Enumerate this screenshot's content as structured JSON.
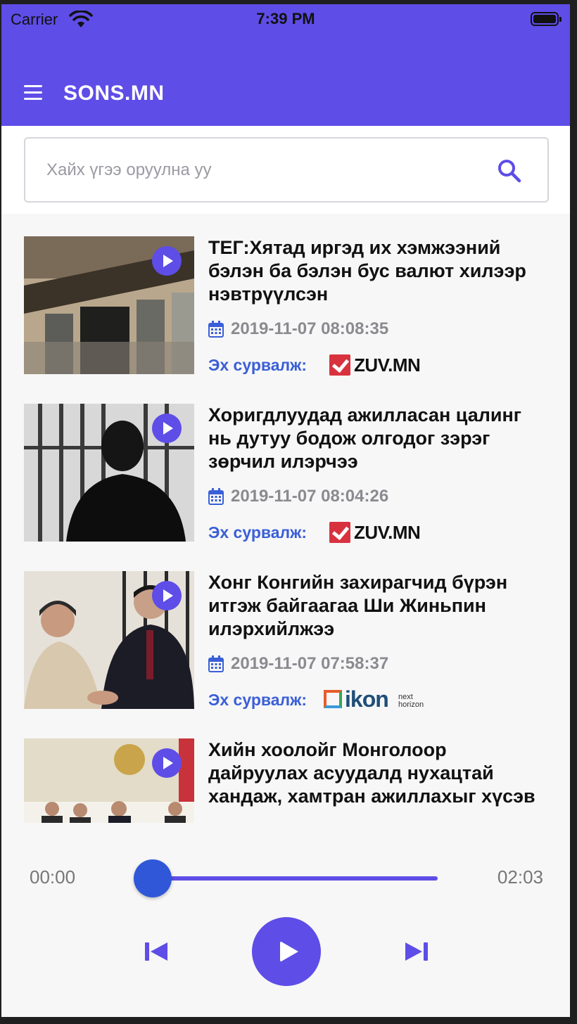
{
  "status_bar": {
    "carrier": "Carrier",
    "time": "7:39 PM"
  },
  "header": {
    "title": "SONS.MN",
    "menu_icon": "hamburger-menu-icon"
  },
  "search": {
    "placeholder": "Хайх үгээ оруулна уу",
    "value": "",
    "icon": "search-icon"
  },
  "colors": {
    "primary": "#5e4de7",
    "accent_blue": "#3a5fd7",
    "thumb_knob": "#2f57d8",
    "date_gray": "#8a8a90"
  },
  "news": [
    {
      "title_lines": [
        "ТЕГ:Хятад иргэд их хэмжээний",
        "бэлэн ба бэлэн бус валют хилээр",
        "нэвтрүүлсэн"
      ],
      "date": "2019-11-07 08:08:35",
      "source_label": "Эх сурвалж:",
      "source": "ZUV.MN"
    },
    {
      "title_lines": [
        "Хоригдлуудад ажилласан цалинг",
        "нь дутуу бодож олгодог зэрэг",
        "зөрчил илэрчээ"
      ],
      "date": "2019-11-07 08:04:26",
      "source_label": "Эх сурвалж:",
      "source": "ZUV.MN"
    },
    {
      "title_lines": [
        "Хонг Конгийн захирагчид бүрэн",
        "итгэж байгаагаа Ши Жиньпин",
        "илэрхийлжээ"
      ],
      "date": "2019-11-07 07:58:37",
      "source_label": "Эх сурвалж:",
      "source": "ikon",
      "source_sub": [
        "next",
        "horizon"
      ]
    },
    {
      "title_lines": [
        "Хийн хоолойг Монголоор",
        "дайруулах асуудалд нухацтай",
        "хандаж, хамтран ажиллахыг хүсэв"
      ]
    }
  ],
  "player": {
    "current_time": "00:00",
    "duration": "02:03",
    "progress": 0.0
  }
}
